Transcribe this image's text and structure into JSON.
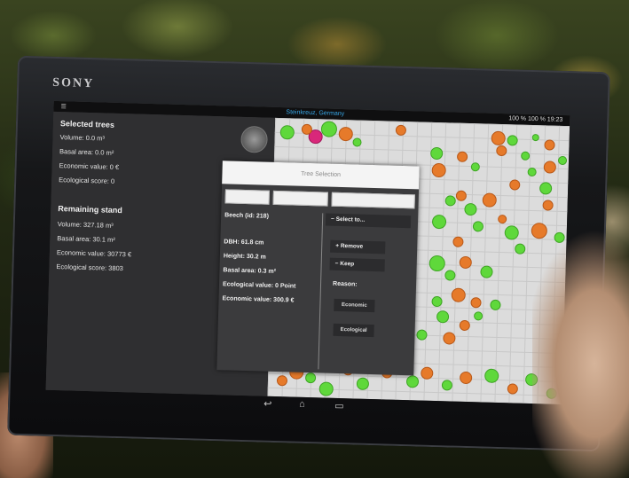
{
  "device_brand": "SONY",
  "status_bar": {
    "menu_icon": "menu-icon",
    "title": "Steinkreuz, Germany",
    "right": "100 % 100 % 19:23"
  },
  "sidebar": {
    "selected": {
      "heading": "Selected trees",
      "volume": "Volume: 0.0 m³",
      "basal_area": "Basal area: 0.0 m²",
      "economic": "Economic value: 0 €",
      "ecological": "Ecological score: 0"
    },
    "remaining": {
      "heading": "Remaining stand",
      "volume": "Volume: 327.18 m³",
      "basal_area": "Basal area: 30.1 m²",
      "economic": "Economic value: 30773 €",
      "ecological": "Ecological score: 3803"
    }
  },
  "dialog": {
    "search_placeholder": "Tree Selection",
    "tree_name": "Beech (id: 218)",
    "dbh": "DBH: 61.8 cm",
    "height": "Height: 30.2 m",
    "basal_area": "Basal area: 0.3 m²",
    "ecological_value": "Ecological value: 0 Point",
    "economic_value": "Economic value: 300.9 €",
    "select_to": "Select to...",
    "remove": "Remove",
    "keep": "Keep",
    "reason_label": "Reason:",
    "reason_economic": "Economic",
    "reason_ecological": "Ecological"
  },
  "colors": {
    "tree_green": "#5fd83b",
    "tree_orange": "#e67a2a",
    "tree_selected": "#d9277a",
    "title_blue": "#38a7e8"
  }
}
